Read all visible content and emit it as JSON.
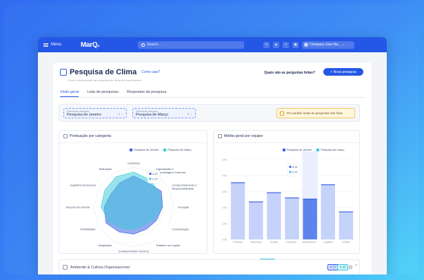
{
  "topbar": {
    "menu_label": "Menu",
    "logo": "MarQ",
    "logo_suffix": "ai",
    "search_placeholder": "Search...",
    "company": "Company User Na..."
  },
  "header": {
    "title": "Pesquisa de Clima",
    "howto": "Como usar?",
    "subtitle": "Envie e acompanhe as pesquisas de clima da sua empresa.",
    "questions_link": "Quais são as perguntas feitas?",
    "new_button": "+ Nova pesquisa"
  },
  "tabs": [
    {
      "label": "Visão geral"
    },
    {
      "label": "Lista de pesquisas"
    },
    {
      "label": "Respostas da pesquisa"
    }
  ],
  "filters": {
    "first": {
      "label": "Selecionar pesquisa",
      "value": "Pesquisa de Janeiro"
    },
    "second": {
      "label": "Selecionar pesquisa",
      "value": "Pesquisa de Março"
    },
    "notice": "Por padrão todas as perguntas são fixas"
  },
  "radar_panel": {
    "title": "Pontuação por categoria"
  },
  "bar_panel": {
    "title": "Média geral por equipe"
  },
  "colors": {
    "primary": "#2457e6",
    "series_a": "#3d63e6",
    "series_b": "#38c9d9"
  },
  "chart_data": [
    {
      "type": "radar",
      "title": "Pontuação por categoria",
      "categories": [
        "Liderança",
        "Capacitação e Aprendizagem Contínua",
        "Comprometimento e Responsabilidade",
        "Inovação",
        "Comunicação",
        "Trabalho em equipe",
        "Conhecimentos Técnicos",
        "Adaptação",
        "Flexibilidade",
        "Sucesso do Cliente",
        "Equilíbrio Emocional",
        "Motivação"
      ],
      "series": [
        {
          "name": "Pesquisa de Janeiro",
          "values": [
            3.9,
            3.5,
            4.0,
            3.6,
            3.3,
            3.2,
            3.4,
            3.6,
            4.0,
            3.7,
            3.3,
            3.5
          ]
        },
        {
          "name": "Pesquisa de Março",
          "values": [
            4.4,
            4.0,
            3.7,
            3.5,
            3.0,
            2.6,
            2.8,
            3.1,
            3.6,
            4.1,
            4.2,
            4.4
          ]
        }
      ],
      "tooltip": {
        "values": [
          "3.22",
          "2.97"
        ]
      }
    },
    {
      "type": "bar",
      "title": "Média geral por equipe",
      "categories": [
        "Pessoas",
        "Marketing",
        "Vendas",
        "Customer...",
        "Atendimento...",
        "Logística",
        "Jurídico"
      ],
      "series": [
        {
          "name": "Pesquisa de Janeiro",
          "values": [
            4.43,
            3.95,
            4.18,
            4.05,
            4.02,
            4.38,
            3.7
          ]
        }
      ],
      "yticks": [
        "5.00",
        "4.00",
        "3.00",
        "2.00",
        "1.00",
        "0.00"
      ],
      "ylim": [
        3.0,
        5.0
      ],
      "legend": [
        "Pesquisa de Janeiro",
        "Pesquisa de março"
      ],
      "tooltip": {
        "values": [
          "3.22",
          "2.97"
        ]
      }
    }
  ],
  "bottom_row": {
    "label": "Ambiente & Cultura Organizacional",
    "score_a": "4.37",
    "score_b": "4.45"
  }
}
